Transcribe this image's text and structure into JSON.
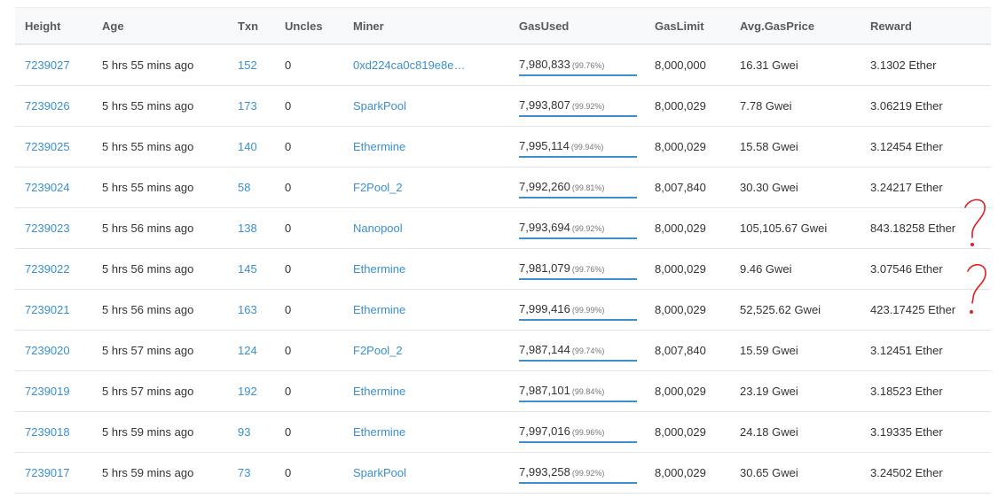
{
  "table": {
    "headers": {
      "height": "Height",
      "age": "Age",
      "txn": "Txn",
      "uncles": "Uncles",
      "miner": "Miner",
      "gas_used": "GasUsed",
      "gas_limit": "GasLimit",
      "avg_gas_price": "Avg.GasPrice",
      "reward": "Reward"
    },
    "rows": [
      {
        "height": "7239027",
        "age": "5 hrs 55 mins ago",
        "txn": "152",
        "uncles": "0",
        "miner": "0xd224ca0c819e8e…",
        "gas_used": "7,980,833",
        "gas_pct": "(99.76%)",
        "gas_fraction": 0.9976,
        "gas_limit": "8,000,000",
        "avg_gas_price": "16.31 Gwei",
        "reward": "3.1302 Ether"
      },
      {
        "height": "7239026",
        "age": "5 hrs 55 mins ago",
        "txn": "173",
        "uncles": "0",
        "miner": "SparkPool",
        "gas_used": "7,993,807",
        "gas_pct": "(99.92%)",
        "gas_fraction": 0.9992,
        "gas_limit": "8,000,029",
        "avg_gas_price": "7.78 Gwei",
        "reward": "3.06219 Ether"
      },
      {
        "height": "7239025",
        "age": "5 hrs 55 mins ago",
        "txn": "140",
        "uncles": "0",
        "miner": "Ethermine",
        "gas_used": "7,995,114",
        "gas_pct": "(99.94%)",
        "gas_fraction": 0.9994,
        "gas_limit": "8,000,029",
        "avg_gas_price": "15.58 Gwei",
        "reward": "3.12454 Ether"
      },
      {
        "height": "7239024",
        "age": "5 hrs 55 mins ago",
        "txn": "58",
        "uncles": "0",
        "miner": "F2Pool_2",
        "gas_used": "7,992,260",
        "gas_pct": "(99.81%)",
        "gas_fraction": 0.9981,
        "gas_limit": "8,007,840",
        "avg_gas_price": "30.30 Gwei",
        "reward": "3.24217 Ether"
      },
      {
        "height": "7239023",
        "age": "5 hrs 56 mins ago",
        "txn": "138",
        "uncles": "0",
        "miner": "Nanopool",
        "gas_used": "7,993,694",
        "gas_pct": "(99.92%)",
        "gas_fraction": 0.9992,
        "gas_limit": "8,000,029",
        "avg_gas_price": "105,105.67 Gwei",
        "reward": "843.18258 Ether"
      },
      {
        "height": "7239022",
        "age": "5 hrs 56 mins ago",
        "txn": "145",
        "uncles": "0",
        "miner": "Ethermine",
        "gas_used": "7,981,079",
        "gas_pct": "(99.76%)",
        "gas_fraction": 0.9976,
        "gas_limit": "8,000,029",
        "avg_gas_price": "9.46 Gwei",
        "reward": "3.07546 Ether"
      },
      {
        "height": "7239021",
        "age": "5 hrs 56 mins ago",
        "txn": "163",
        "uncles": "0",
        "miner": "Ethermine",
        "gas_used": "7,999,416",
        "gas_pct": "(99.99%)",
        "gas_fraction": 0.9999,
        "gas_limit": "8,000,029",
        "avg_gas_price": "52,525.62 Gwei",
        "reward": "423.17425 Ether"
      },
      {
        "height": "7239020",
        "age": "5 hrs 57 mins ago",
        "txn": "124",
        "uncles": "0",
        "miner": "F2Pool_2",
        "gas_used": "7,987,144",
        "gas_pct": "(99.74%)",
        "gas_fraction": 0.9974,
        "gas_limit": "8,007,840",
        "avg_gas_price": "15.59 Gwei",
        "reward": "3.12451 Ether"
      },
      {
        "height": "7239019",
        "age": "5 hrs 57 mins ago",
        "txn": "192",
        "uncles": "0",
        "miner": "Ethermine",
        "gas_used": "7,987,101",
        "gas_pct": "(99.84%)",
        "gas_fraction": 0.9984,
        "gas_limit": "8,000,029",
        "avg_gas_price": "23.19 Gwei",
        "reward": "3.18523 Ether"
      },
      {
        "height": "7239018",
        "age": "5 hrs 59 mins ago",
        "txn": "93",
        "uncles": "0",
        "miner": "Ethermine",
        "gas_used": "7,997,016",
        "gas_pct": "(99.96%)",
        "gas_fraction": 0.9996,
        "gas_limit": "8,000,029",
        "avg_gas_price": "24.18 Gwei",
        "reward": "3.19335 Ether"
      },
      {
        "height": "7239017",
        "age": "5 hrs 59 mins ago",
        "txn": "73",
        "uncles": "0",
        "miner": "SparkPool",
        "gas_used": "7,993,258",
        "gas_pct": "(99.92%)",
        "gas_fraction": 0.9992,
        "gas_limit": "8,000,029",
        "avg_gas_price": "30.65 Gwei",
        "reward": "3.24502 Ether"
      }
    ]
  },
  "annotations": {
    "marks": [
      "question-mark",
      "question-mark"
    ],
    "color": "#e02020"
  },
  "colors": {
    "link": "#3a8fcf",
    "gas_bar": "#3a8fcf",
    "header_bg": "#f8f9fa"
  }
}
